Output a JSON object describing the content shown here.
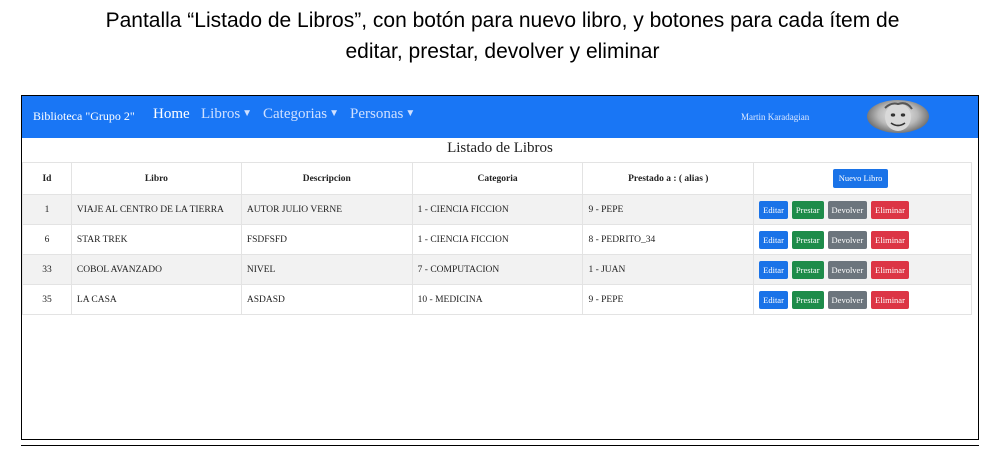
{
  "caption": {
    "line1": "Pantalla “Listado de Libros”, con botón para nuevo libro, y botones para cada ítem de",
    "line2": "editar, prestar, devolver y  eliminar"
  },
  "navbar": {
    "brand": "Biblioteca \"Grupo 2\"",
    "home": "Home",
    "libros": "Libros",
    "categorias": "Categorias",
    "personas": "Personas",
    "user": "Martin Karadagian",
    "colors": {
      "bar": "#1976f5"
    }
  },
  "page": {
    "title": "Listado de Libros"
  },
  "table": {
    "headers": {
      "id": "Id",
      "libro": "Libro",
      "descripcion": "Descripcion",
      "categoria": "Categoria",
      "prestado": "Prestado a : ( alias )"
    },
    "new_button": "Nuevo Libro",
    "actions": {
      "edit": "Editar",
      "lend": "Prestar",
      "return": "Devolver",
      "delete": "Eliminar"
    },
    "rows": [
      {
        "id": "1",
        "libro": "VIAJE AL CENTRO DE LA TIERRA",
        "descripcion": "AUTOR JULIO VERNE",
        "categoria": "1 - CIENCIA FICCION",
        "prestado": "9 - PEPE"
      },
      {
        "id": "6",
        "libro": "STAR TREK",
        "descripcion": "FSDFSFD",
        "categoria": "1 - CIENCIA FICCION",
        "prestado": "8 - PEDRITO_34"
      },
      {
        "id": "33",
        "libro": "COBOL AVANZADO",
        "descripcion": "NIVEL",
        "categoria": "7 - COMPUTACION",
        "prestado": "1 - JUAN"
      },
      {
        "id": "35",
        "libro": "LA CASA",
        "descripcion": "ASDASD",
        "categoria": "10 - MEDICINA",
        "prestado": "9 - PEPE"
      }
    ]
  }
}
